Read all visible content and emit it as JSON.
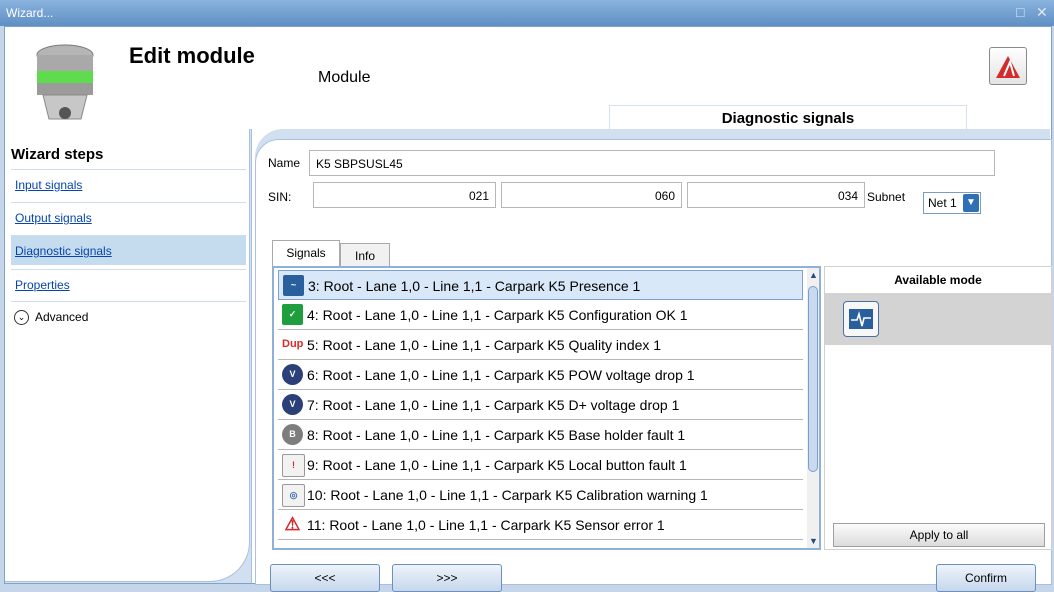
{
  "window": {
    "title": "Wizard..."
  },
  "header": {
    "title": "Edit module",
    "subtitle": "Module",
    "section_tab": "Diagnostic signals"
  },
  "sidebar": {
    "title": "Wizard steps",
    "items": [
      {
        "label": "Input signals"
      },
      {
        "label": "Output signals"
      },
      {
        "label": "Diagnostic signals"
      },
      {
        "label": "Properties"
      }
    ],
    "advanced_label": "Advanced"
  },
  "form": {
    "name_label": "Name",
    "name_value": "K5 SBPSUSL45",
    "sin_label": "SIN:",
    "sin_values": [
      "021",
      "060",
      "034"
    ],
    "subnet_label": "Subnet",
    "subnet_value": "Net 1"
  },
  "tabs": [
    {
      "label": "Signals"
    },
    {
      "label": "Info"
    }
  ],
  "signals": [
    {
      "text": "3: Root - Lane 1,0 - Line 1,1 - Carpark K5 Presence 1",
      "icon": "presence-signal-icon"
    },
    {
      "text": "4: Root - Lane 1,0 - Line 1,1 - Carpark K5 Configuration OK 1",
      "icon": "configuration-ok-icon"
    },
    {
      "text": "5: Root - Lane 1,0 - Line 1,1 - Carpark K5 Quality index 1",
      "icon": "quality-index-icon",
      "icon_text": "Dup"
    },
    {
      "text": "6: Root - Lane 1,0 - Line 1,1 - Carpark K5 POW voltage drop 1",
      "icon": "pow-voltage-icon",
      "icon_text": "V"
    },
    {
      "text": "7: Root - Lane 1,0 - Line 1,1 - Carpark K5 D+ voltage drop 1",
      "icon": "dplus-voltage-icon",
      "icon_text": "V"
    },
    {
      "text": "8: Root - Lane 1,0 - Line 1,1 - Carpark K5 Base holder fault 1",
      "icon": "base-holder-fault-icon"
    },
    {
      "text": "9: Root - Lane 1,0 - Line 1,1 - Carpark K5 Local button fault 1",
      "icon": "local-button-fault-icon"
    },
    {
      "text": "10: Root - Lane 1,0 - Line 1,1 - Carpark K5 Calibration warning 1",
      "icon": "calibration-warning-icon"
    },
    {
      "text": "11: Root - Lane 1,0 - Line 1,1 - Carpark K5 Sensor error 1",
      "icon": "sensor-error-icon"
    }
  ],
  "modes": {
    "title": "Available mode",
    "apply_label": "Apply to all"
  },
  "buttons": {
    "prev": "<<<",
    "next": ">>>",
    "confirm": "Confirm"
  },
  "colors": {
    "accent": "#2f6fb5",
    "selection": "#c5dcef",
    "link": "#0645ad"
  }
}
